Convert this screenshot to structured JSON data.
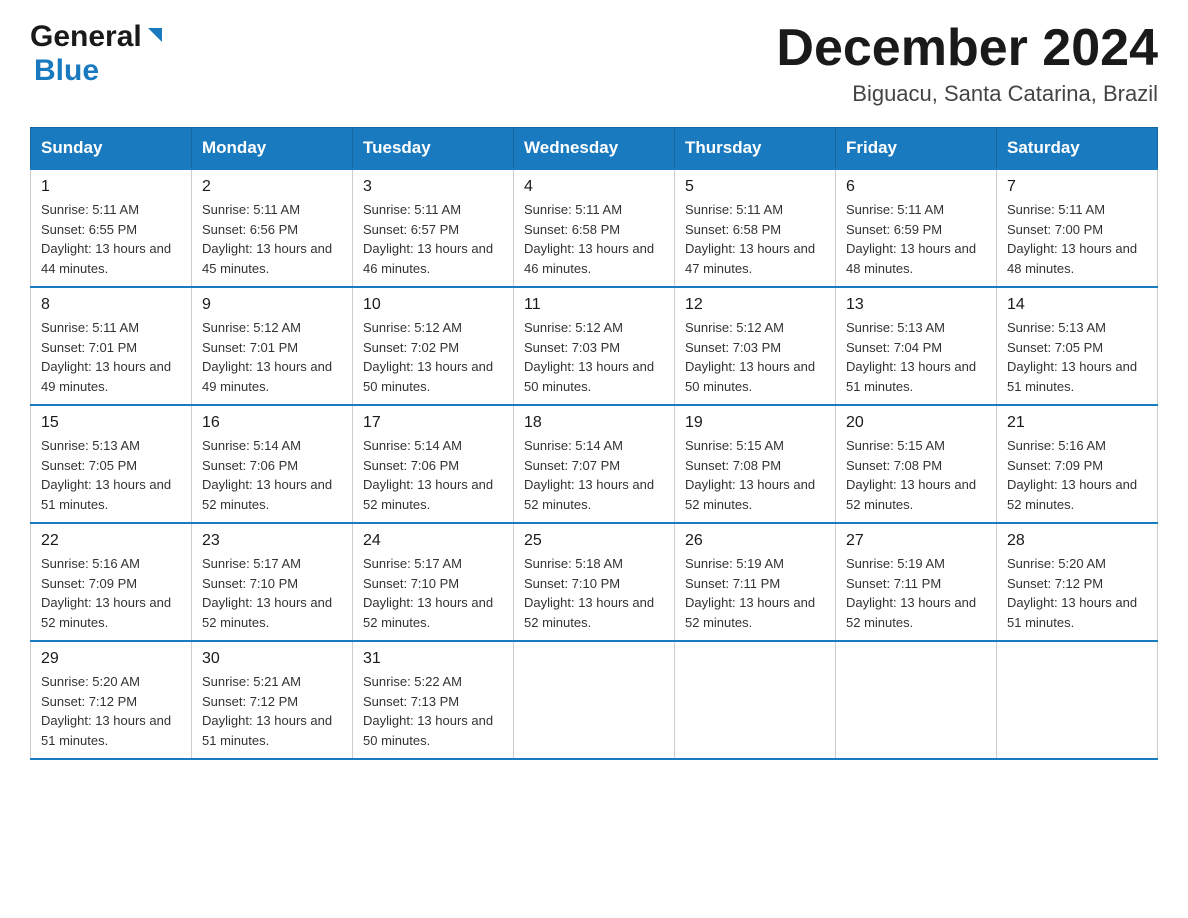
{
  "header": {
    "logo_general": "General",
    "logo_blue": "Blue",
    "month_title": "December 2024",
    "location": "Biguacu, Santa Catarina, Brazil"
  },
  "days_of_week": [
    "Sunday",
    "Monday",
    "Tuesday",
    "Wednesday",
    "Thursday",
    "Friday",
    "Saturday"
  ],
  "weeks": [
    [
      {
        "day": "1",
        "sunrise": "5:11 AM",
        "sunset": "6:55 PM",
        "daylight": "13 hours and 44 minutes."
      },
      {
        "day": "2",
        "sunrise": "5:11 AM",
        "sunset": "6:56 PM",
        "daylight": "13 hours and 45 minutes."
      },
      {
        "day": "3",
        "sunrise": "5:11 AM",
        "sunset": "6:57 PM",
        "daylight": "13 hours and 46 minutes."
      },
      {
        "day": "4",
        "sunrise": "5:11 AM",
        "sunset": "6:58 PM",
        "daylight": "13 hours and 46 minutes."
      },
      {
        "day": "5",
        "sunrise": "5:11 AM",
        "sunset": "6:58 PM",
        "daylight": "13 hours and 47 minutes."
      },
      {
        "day": "6",
        "sunrise": "5:11 AM",
        "sunset": "6:59 PM",
        "daylight": "13 hours and 48 minutes."
      },
      {
        "day": "7",
        "sunrise": "5:11 AM",
        "sunset": "7:00 PM",
        "daylight": "13 hours and 48 minutes."
      }
    ],
    [
      {
        "day": "8",
        "sunrise": "5:11 AM",
        "sunset": "7:01 PM",
        "daylight": "13 hours and 49 minutes."
      },
      {
        "day": "9",
        "sunrise": "5:12 AM",
        "sunset": "7:01 PM",
        "daylight": "13 hours and 49 minutes."
      },
      {
        "day": "10",
        "sunrise": "5:12 AM",
        "sunset": "7:02 PM",
        "daylight": "13 hours and 50 minutes."
      },
      {
        "day": "11",
        "sunrise": "5:12 AM",
        "sunset": "7:03 PM",
        "daylight": "13 hours and 50 minutes."
      },
      {
        "day": "12",
        "sunrise": "5:12 AM",
        "sunset": "7:03 PM",
        "daylight": "13 hours and 50 minutes."
      },
      {
        "day": "13",
        "sunrise": "5:13 AM",
        "sunset": "7:04 PM",
        "daylight": "13 hours and 51 minutes."
      },
      {
        "day": "14",
        "sunrise": "5:13 AM",
        "sunset": "7:05 PM",
        "daylight": "13 hours and 51 minutes."
      }
    ],
    [
      {
        "day": "15",
        "sunrise": "5:13 AM",
        "sunset": "7:05 PM",
        "daylight": "13 hours and 51 minutes."
      },
      {
        "day": "16",
        "sunrise": "5:14 AM",
        "sunset": "7:06 PM",
        "daylight": "13 hours and 52 minutes."
      },
      {
        "day": "17",
        "sunrise": "5:14 AM",
        "sunset": "7:06 PM",
        "daylight": "13 hours and 52 minutes."
      },
      {
        "day": "18",
        "sunrise": "5:14 AM",
        "sunset": "7:07 PM",
        "daylight": "13 hours and 52 minutes."
      },
      {
        "day": "19",
        "sunrise": "5:15 AM",
        "sunset": "7:08 PM",
        "daylight": "13 hours and 52 minutes."
      },
      {
        "day": "20",
        "sunrise": "5:15 AM",
        "sunset": "7:08 PM",
        "daylight": "13 hours and 52 minutes."
      },
      {
        "day": "21",
        "sunrise": "5:16 AM",
        "sunset": "7:09 PM",
        "daylight": "13 hours and 52 minutes."
      }
    ],
    [
      {
        "day": "22",
        "sunrise": "5:16 AM",
        "sunset": "7:09 PM",
        "daylight": "13 hours and 52 minutes."
      },
      {
        "day": "23",
        "sunrise": "5:17 AM",
        "sunset": "7:10 PM",
        "daylight": "13 hours and 52 minutes."
      },
      {
        "day": "24",
        "sunrise": "5:17 AM",
        "sunset": "7:10 PM",
        "daylight": "13 hours and 52 minutes."
      },
      {
        "day": "25",
        "sunrise": "5:18 AM",
        "sunset": "7:10 PM",
        "daylight": "13 hours and 52 minutes."
      },
      {
        "day": "26",
        "sunrise": "5:19 AM",
        "sunset": "7:11 PM",
        "daylight": "13 hours and 52 minutes."
      },
      {
        "day": "27",
        "sunrise": "5:19 AM",
        "sunset": "7:11 PM",
        "daylight": "13 hours and 52 minutes."
      },
      {
        "day": "28",
        "sunrise": "5:20 AM",
        "sunset": "7:12 PM",
        "daylight": "13 hours and 51 minutes."
      }
    ],
    [
      {
        "day": "29",
        "sunrise": "5:20 AM",
        "sunset": "7:12 PM",
        "daylight": "13 hours and 51 minutes."
      },
      {
        "day": "30",
        "sunrise": "5:21 AM",
        "sunset": "7:12 PM",
        "daylight": "13 hours and 51 minutes."
      },
      {
        "day": "31",
        "sunrise": "5:22 AM",
        "sunset": "7:13 PM",
        "daylight": "13 hours and 50 minutes."
      },
      null,
      null,
      null,
      null
    ]
  ],
  "labels": {
    "sunrise": "Sunrise:",
    "sunset": "Sunset:",
    "daylight": "Daylight:"
  }
}
